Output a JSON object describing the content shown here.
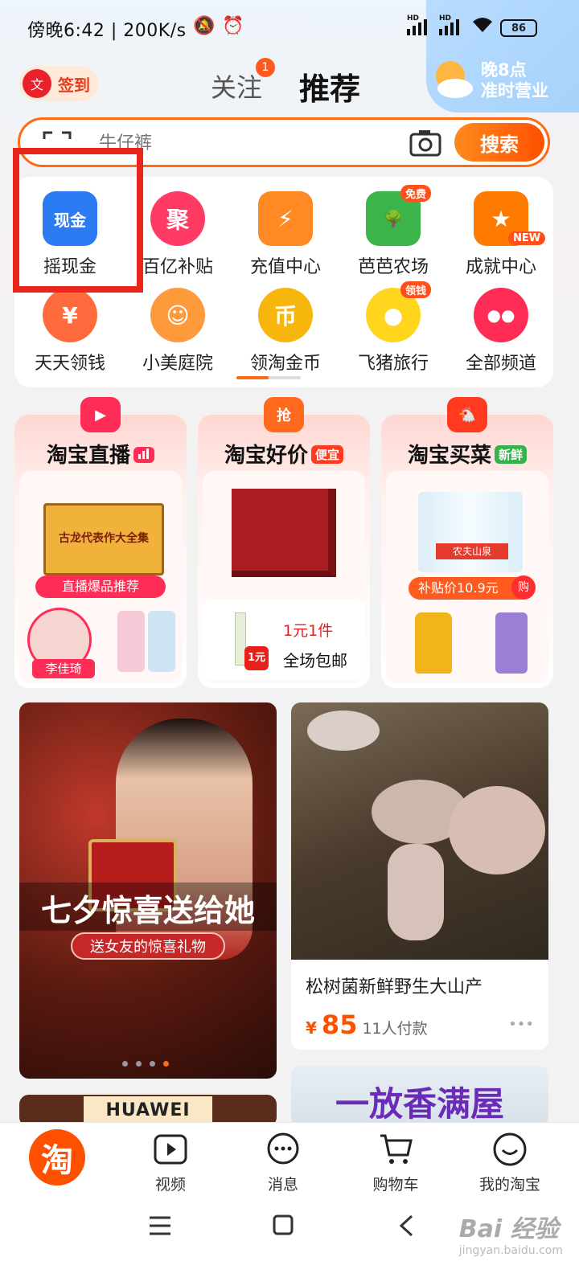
{
  "status_bar": {
    "time_speed": "傍晚6:42 | 200K/s",
    "battery": "86"
  },
  "header": {
    "signin_label": "签到",
    "signin_icon_char": "文",
    "tab_follow": "关注",
    "tab_follow_badge": "1",
    "tab_recommend": "推荐",
    "weather_line1": "晚8点",
    "weather_line2": "准时营业"
  },
  "search": {
    "placeholder": "牛仔裤",
    "button": "搜索"
  },
  "channels": [
    {
      "label": "摇现金",
      "icon_text": "现金",
      "color": "#2b7bf2"
    },
    {
      "label": "百亿补贴",
      "icon_text": "聚",
      "color": "#ff3a63"
    },
    {
      "label": "充值中心",
      "icon_text": "⚡",
      "color": "#ff8a23"
    },
    {
      "label": "芭芭农场",
      "icon_text": "🌳",
      "color": "#3bb54a",
      "tag": "免费"
    },
    {
      "label": "成就中心",
      "icon_text": "★",
      "color": "#ff7a00",
      "tag": "NEW"
    },
    {
      "label": "天天领钱",
      "icon_text": "¥",
      "color": "#ff6b3d"
    },
    {
      "label": "小美庭院",
      "icon_text": "☺",
      "color": "#ff9a3c"
    },
    {
      "label": "领淘金币",
      "icon_text": "币",
      "color": "#f6b60c"
    },
    {
      "label": "飞猪旅行",
      "icon_text": "●",
      "color": "#ffd51e",
      "tag": "领钱"
    },
    {
      "label": "全部频道",
      "icon_text": "●●",
      "color": "#ff2d55"
    }
  ],
  "promos": [
    {
      "title": "淘宝直播",
      "pill": "",
      "pill_color": "#ff2d55",
      "top_icon": "▶",
      "top_color": "#ff2d55",
      "caption": "直播爆品推荐",
      "product": "古龙代表作大全集",
      "person": "李佳琦"
    },
    {
      "title": "淘宝好价",
      "pill": "便宜",
      "pill_color": "#ff3a1e",
      "top_icon": "抢",
      "top_color": "#ff6a1e",
      "deal_price": "1元1件",
      "deal_text": "全场包邮",
      "deal_badge": "1元"
    },
    {
      "title": "淘宝买菜",
      "pill": "新鲜",
      "pill_color": "#35b34a",
      "top_icon": "🐔",
      "top_color": "#ff3a1e",
      "subsidy": "补贴价10.9元",
      "subsidy_tag": "购",
      "water_brand": "农夫山泉"
    }
  ],
  "feed": {
    "banner_title": "七夕惊喜送给她",
    "banner_sub": "送女友的惊喜礼物",
    "product_title": "松树菌新鲜野生大山产",
    "price_symbol": "¥",
    "price": "85",
    "buyers": "11人付款",
    "more": "•••",
    "huawei": "HUAWEI",
    "incense": "一放香满屋"
  },
  "bottom_nav": [
    {
      "label": "",
      "home": true
    },
    {
      "label": "视频"
    },
    {
      "label": "消息"
    },
    {
      "label": "购物车"
    },
    {
      "label": "我的淘宝"
    }
  ],
  "watermark": {
    "brand": "Bai 经验",
    "url": "jingyan.baidu.com"
  }
}
